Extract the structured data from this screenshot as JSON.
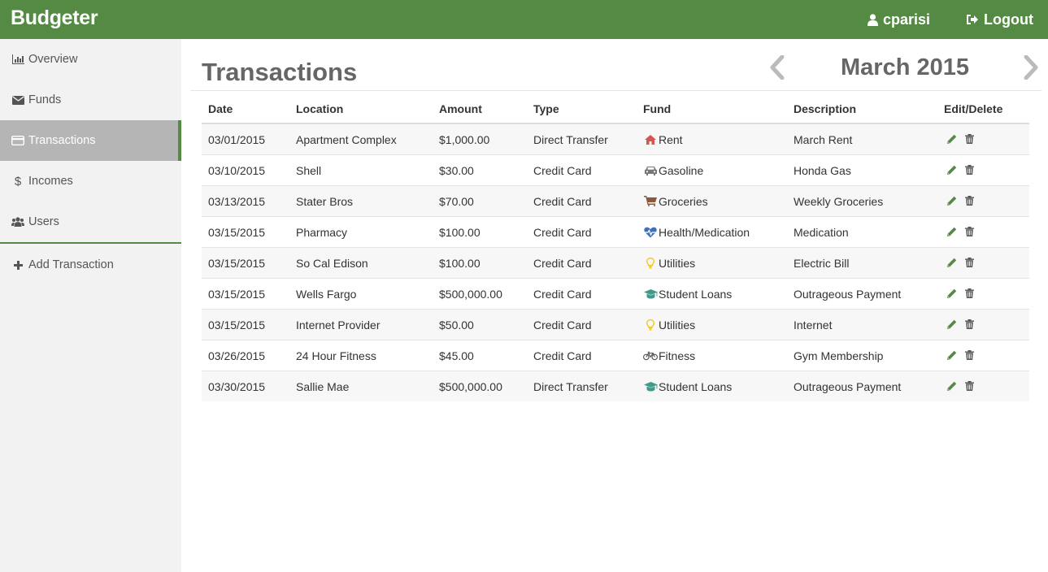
{
  "app": {
    "brand": "Budgeter"
  },
  "navbar": {
    "user_label": "cparisi",
    "logout_label": "Logout"
  },
  "sidebar": {
    "items": [
      {
        "label": "Overview",
        "icon": "bar-chart-icon"
      },
      {
        "label": "Funds",
        "icon": "envelope-icon"
      },
      {
        "label": "Transactions",
        "icon": "credit-card-icon",
        "active": true
      },
      {
        "label": "Incomes",
        "icon": "dollar-icon"
      },
      {
        "label": "Users",
        "icon": "users-icon"
      }
    ],
    "add_label": "Add Transaction"
  },
  "page": {
    "title": "Transactions",
    "month": "March 2015"
  },
  "table": {
    "headers": [
      "Date",
      "Location",
      "Amount",
      "Type",
      "Fund",
      "Description",
      "Edit/Delete"
    ],
    "rows": [
      {
        "date": "03/01/2015",
        "location": "Apartment Complex",
        "amount": "$1,000.00",
        "type": "Direct Transfer",
        "fund": "Rent",
        "fund_icon": "home-icon",
        "description": "March Rent"
      },
      {
        "date": "03/10/2015",
        "location": "Shell",
        "amount": "$30.00",
        "type": "Credit Card",
        "fund": "Gasoline",
        "fund_icon": "car-icon",
        "description": "Honda Gas"
      },
      {
        "date": "03/13/2015",
        "location": "Stater Bros",
        "amount": "$70.00",
        "type": "Credit Card",
        "fund": "Groceries",
        "fund_icon": "shopping-cart-icon",
        "description": "Weekly Groceries"
      },
      {
        "date": "03/15/2015",
        "location": "Pharmacy",
        "amount": "$100.00",
        "type": "Credit Card",
        "fund": "Health/Medication",
        "fund_icon": "heartbeat-icon",
        "description": "Medication"
      },
      {
        "date": "03/15/2015",
        "location": "So Cal Edison",
        "amount": "$100.00",
        "type": "Credit Card",
        "fund": "Utilities",
        "fund_icon": "lightbulb-icon",
        "description": "Electric Bill"
      },
      {
        "date": "03/15/2015",
        "location": "Wells Fargo",
        "amount": "$500,000.00",
        "type": "Credit Card",
        "fund": "Student Loans",
        "fund_icon": "graduation-cap-icon",
        "description": "Outrageous Payment"
      },
      {
        "date": "03/15/2015",
        "location": "Internet Provider",
        "amount": "$50.00",
        "type": "Credit Card",
        "fund": "Utilities",
        "fund_icon": "lightbulb-icon",
        "description": "Internet"
      },
      {
        "date": "03/26/2015",
        "location": "24 Hour Fitness",
        "amount": "$45.00",
        "type": "Credit Card",
        "fund": "Fitness",
        "fund_icon": "bicycle-icon",
        "description": "Gym Membership"
      },
      {
        "date": "03/30/2015",
        "location": "Sallie Mae",
        "amount": "$500,000.00",
        "type": "Direct Transfer",
        "fund": "Student Loans",
        "fund_icon": "graduation-cap-icon",
        "description": "Outrageous Payment"
      }
    ]
  },
  "colors": {
    "brand_green": "#548a43",
    "rent_icon": "#d9534f",
    "car_icon": "#777777",
    "cart_icon": "#8a5a3c",
    "health_icon": "#3f6fb5",
    "utilities_icon": "#f0c419",
    "loans_icon": "#3f9a8a",
    "fitness_icon": "#555555"
  }
}
